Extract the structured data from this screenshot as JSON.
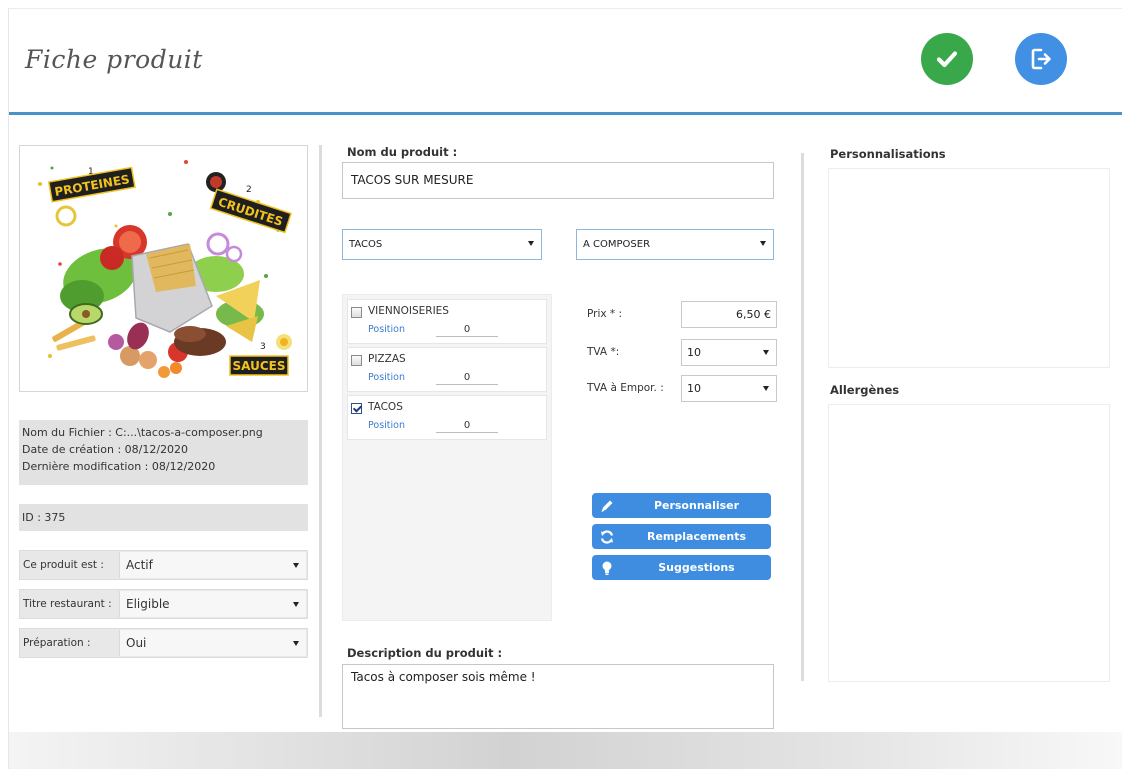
{
  "header": {
    "title": "Fiche produit",
    "validate_icon": "check-icon",
    "exit_icon": "logout-icon",
    "validate_color": "#39a84b",
    "exit_color": "#4190e4",
    "accent_rule_color": "#4a93c9"
  },
  "image_panel": {
    "badges": {
      "n1": "1",
      "proteines": "PROTEINES",
      "n2": "2",
      "crudites": "CRUDITES",
      "n3": "3",
      "sauces": "SAUCES"
    }
  },
  "file_info": {
    "name_label": "Nom du Fichier :",
    "name_value": "C:...\\tacos-a-composer.png",
    "created_label": "Date de création :",
    "created_value": "08/12/2020",
    "modified_label": "Dernière modification :",
    "modified_value": "08/12/2020"
  },
  "id_text": "ID : 375",
  "fields": {
    "status": {
      "label": "Ce produit est :",
      "value": "Actif"
    },
    "meal_voucher": {
      "label": "Titre restaurant :",
      "value": "Eligible"
    },
    "preparation": {
      "label": "Préparation :",
      "value": "Oui"
    }
  },
  "product": {
    "name_label": "Nom du produit :",
    "name_value": "TACOS SUR MESURE",
    "category_select": "TACOS",
    "type_select": "A COMPOSER",
    "description_label": "Description du produit :",
    "description_value": "Tacos à composer sois même !"
  },
  "categories": [
    {
      "name": "VIENNOISERIES",
      "position_label": "Position",
      "position_value": "0",
      "checked": false
    },
    {
      "name": "PIZZAS",
      "position_label": "Position",
      "position_value": "0",
      "checked": false
    },
    {
      "name": "TACOS",
      "position_label": "Position",
      "position_value": "0",
      "checked": true
    }
  ],
  "pricing": {
    "price_label": "Prix * :",
    "price_value": "6,50 €",
    "tva_label": "TVA *:",
    "tva_value": "10",
    "tva_takeaway_label": "TVA à Empor. :",
    "tva_takeaway_value": "10"
  },
  "actions": {
    "customize": {
      "label": "Personnaliser",
      "icon": "pencil-icon"
    },
    "replacements": {
      "label": "Remplacements",
      "icon": "refresh-icon"
    },
    "suggestions": {
      "label": "Suggestions",
      "icon": "lightbulb-icon"
    }
  },
  "right_panels": {
    "customizations_title": "Personnalisations",
    "allergens_title": "Allergènes"
  }
}
